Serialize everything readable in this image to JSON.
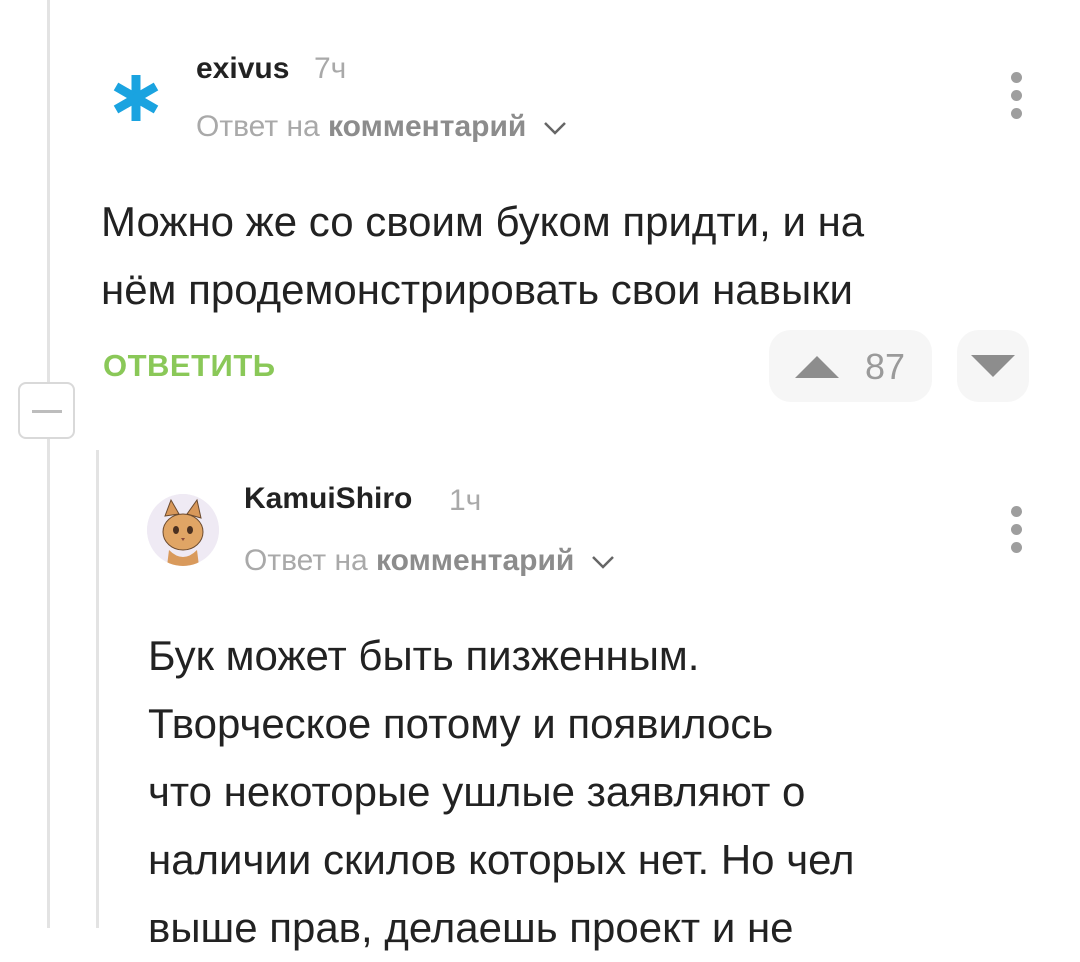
{
  "comments": [
    {
      "username": "exivus",
      "time": "7ч",
      "reply_prefix": "Ответ на",
      "reply_target": "комментарий",
      "text": "Можно же со своим буком придти, и на\nнём продемонстрировать свои навыки",
      "reply_label": "ОТВЕТИТЬ",
      "rating": "87"
    },
    {
      "username": "KamuiShiro",
      "time": "1ч",
      "reply_prefix": "Ответ на",
      "reply_target": "комментарий",
      "text": "Бук может быть пизженным.\nТворческое потому и появилось\nчто некоторые ушлые заявляют о\nналичии скилов которых нет. Но чел\nвыше прав, делаешь проект и не"
    }
  ],
  "colors": {
    "accent_green": "#8ac858",
    "star_blue": "#1aa3e0"
  }
}
